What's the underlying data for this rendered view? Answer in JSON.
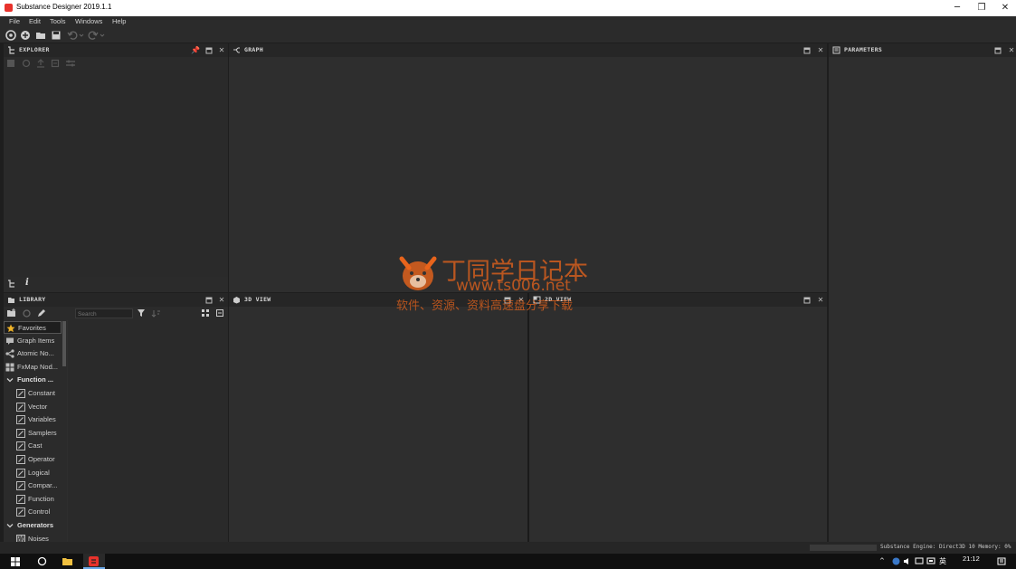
{
  "window": {
    "title": "Substance Designer 2019.1.1",
    "minimize": "─",
    "restore": "❐",
    "close": "✕"
  },
  "menu": [
    "File",
    "Edit",
    "Tools",
    "Windows",
    "Help"
  ],
  "panels": {
    "explorer": {
      "title": "EXPLORER"
    },
    "graph": {
      "title": "GRAPH"
    },
    "parameters": {
      "title": "PARAMETERS"
    },
    "library": {
      "title": "LIBRARY",
      "search_placeholder": "Search"
    },
    "view3d": {
      "title": "3D VIEW"
    },
    "view2d": {
      "title": "2D VIEW"
    }
  },
  "library_items": [
    {
      "label": "Favorites",
      "icon": "star-icon",
      "type": "top"
    },
    {
      "label": "Graph Items",
      "icon": "comment-icon",
      "type": "top"
    },
    {
      "label": "Atomic No...",
      "icon": "node-icon",
      "type": "top"
    },
    {
      "label": "FxMap Nod...",
      "icon": "grid-icon",
      "type": "top"
    },
    {
      "label": "Function ...",
      "icon": "chevron-down-icon",
      "type": "cat"
    },
    {
      "label": "Constant",
      "icon": "function-icon",
      "type": "child"
    },
    {
      "label": "Vector",
      "icon": "function-icon",
      "type": "child"
    },
    {
      "label": "Variables",
      "icon": "function-icon",
      "type": "child"
    },
    {
      "label": "Samplers",
      "icon": "function-icon",
      "type": "child"
    },
    {
      "label": "Cast",
      "icon": "function-icon",
      "type": "child"
    },
    {
      "label": "Operator",
      "icon": "function-icon",
      "type": "child"
    },
    {
      "label": "Logical",
      "icon": "function-icon",
      "type": "child"
    },
    {
      "label": "Compar...",
      "icon": "function-icon",
      "type": "child"
    },
    {
      "label": "Function",
      "icon": "function-icon",
      "type": "child"
    },
    {
      "label": "Control",
      "icon": "function-icon",
      "type": "child"
    },
    {
      "label": "Generators",
      "icon": "chevron-down-icon",
      "type": "cat"
    },
    {
      "label": "Noises",
      "icon": "noise-icon",
      "type": "child"
    }
  ],
  "status": {
    "engine": "Substance Engine: Direct3D 10 Memory: 0%"
  },
  "taskbar": {
    "time": "21:12"
  },
  "watermark": {
    "title": "丁同学日记本",
    "url": "www.ts006.net",
    "tagline": "软件、资源、资料高速盘分享下载"
  },
  "colors": {
    "accent": "#e8322c",
    "panel_bg": "#2e2e2e",
    "header_bg": "#262626",
    "watermark": "#e8641c"
  }
}
